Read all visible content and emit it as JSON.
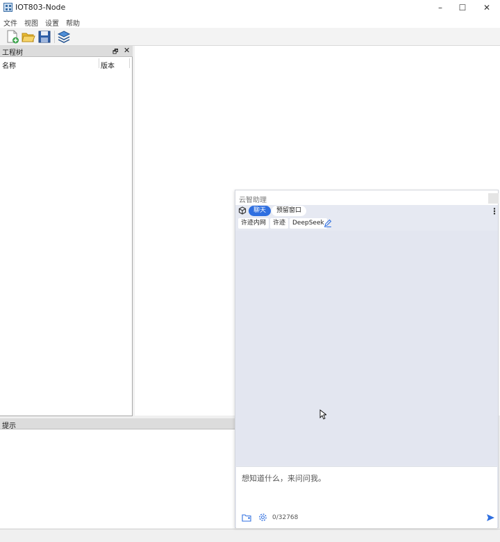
{
  "window": {
    "title": "IOT803-Node",
    "controls": [
      "–",
      "☐",
      "✕"
    ]
  },
  "menu": {
    "items": [
      "文件",
      "视图",
      "设置",
      "帮助"
    ]
  },
  "toolbar": {
    "icons": [
      "new-file-icon",
      "open-folder-icon",
      "save-icon",
      "layers-icon"
    ]
  },
  "project_tree": {
    "title": "工程树",
    "float_symbol": "🗗",
    "close_symbol": "✕",
    "columns": [
      "名称",
      "版本"
    ]
  },
  "hint_panel": {
    "title": "提示"
  },
  "assistant": {
    "title": "云智助理",
    "tabs": [
      "聊天",
      "预留窗口"
    ],
    "active_tab": "聊天",
    "models": [
      "许迹内网",
      "许迹",
      "DeepSeek"
    ],
    "input_placeholder": "想知道什么，来问问我。",
    "char_count": "0/32768",
    "accent_color": "#2f6fe0"
  }
}
